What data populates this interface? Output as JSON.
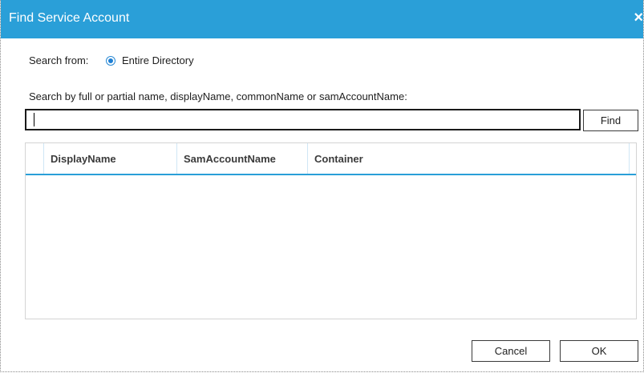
{
  "window": {
    "title": "Find Service Account",
    "close_glyph": "×"
  },
  "search_from": {
    "label": "Search from:",
    "option_label": "Entire Directory",
    "selected": true
  },
  "search": {
    "instruction": "Search by full or partial name, displayName, commonName or samAccountName:",
    "value": "",
    "find_label": "Find"
  },
  "results": {
    "columns": [
      "DisplayName",
      "SamAccountName",
      "Container"
    ],
    "rows": []
  },
  "footer": {
    "cancel_label": "Cancel",
    "ok_label": "OK"
  },
  "colors": {
    "accent": "#2a9fd8",
    "radio": "#1e7fd4"
  }
}
